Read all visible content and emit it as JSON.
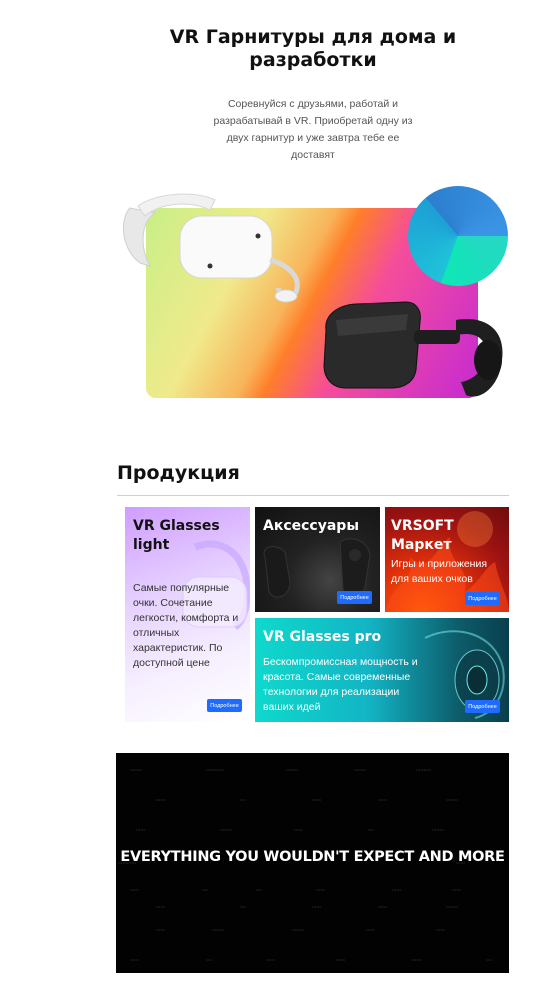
{
  "hero": {
    "title": "VR Гарнитуры для дома и разработки",
    "subtitle": "Соревнуйся с друзьями, работай и разрабатывай в VR. Приобретай одну из двух гарнитур и уже завтра тебе ее доставят"
  },
  "products": {
    "section_title": "Продукция",
    "cards": [
      {
        "title": "VR Glasses light",
        "description": "Самые популярные очки. Сочетание легкости, комфорта и отличных характеристик. По доступной цене",
        "button": "Подробнее"
      },
      {
        "title": "Аксессуары",
        "description": "",
        "button": "Подробнее"
      },
      {
        "title": "VRSOFT Маркет",
        "description": "Игры и приложения для ваших очков",
        "button": "Подробнее"
      },
      {
        "title": "VR Glasses pro",
        "description": "Бескомпромиссная мощность и красота. Самые современные технологии для реализации ваших идей",
        "button": "Подробнее"
      }
    ]
  },
  "promo": {
    "headline": "EVERYTHING YOU WOULDN'T EXPECT AND MORE"
  },
  "colors": {
    "accent": "#1f6bff",
    "text": "#111111",
    "promo_bg": "#020202"
  }
}
